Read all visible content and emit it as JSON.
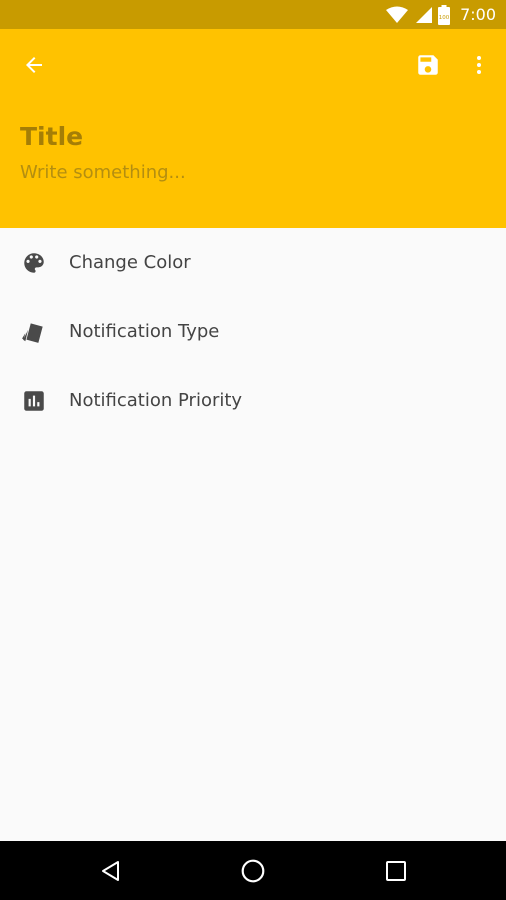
{
  "status_bar": {
    "time": "7:00",
    "battery_level": "100",
    "background_color": "#C89B00"
  },
  "header": {
    "background_color": "#FFC200",
    "back_icon": "arrow-back-icon",
    "save_icon": "save-icon",
    "more_icon": "more-vert-icon",
    "title_placeholder": "Title",
    "body_placeholder": "Write something..."
  },
  "menu": {
    "items": [
      {
        "label": "Change Color",
        "icon": "palette-icon"
      },
      {
        "label": "Notification Type",
        "icon": "cards-icon"
      },
      {
        "label": "Notification Priority",
        "icon": "bar-chart-icon"
      }
    ]
  },
  "nav_bar": {
    "back_icon": "nav-back-icon",
    "home_icon": "nav-home-icon",
    "recents_icon": "nav-recents-icon"
  }
}
